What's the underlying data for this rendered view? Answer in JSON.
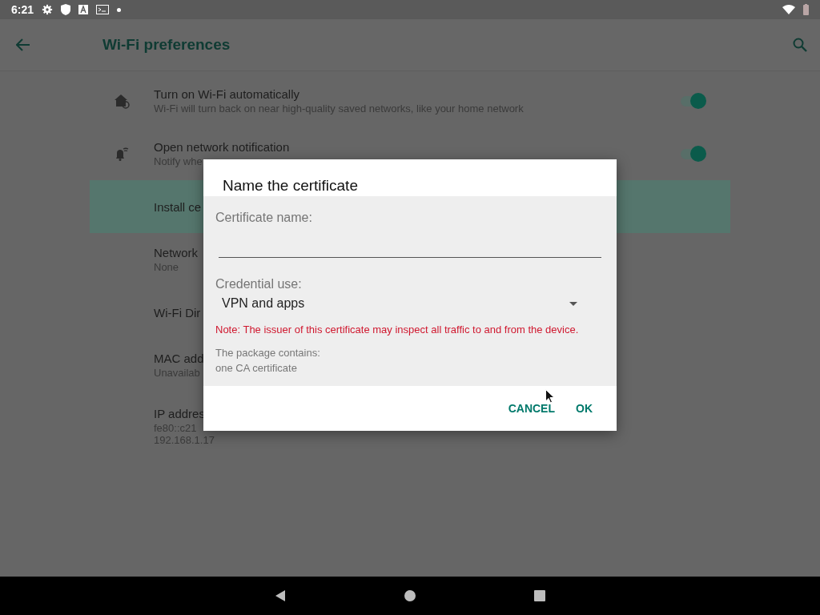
{
  "status_bar": {
    "time": "6:21"
  },
  "app_bar": {
    "title": "Wi-Fi preferences"
  },
  "settings": [
    {
      "title": "Turn on Wi-Fi automatically",
      "summary": "Wi-Fi will turn back on near high-quality saved networks, like your home network",
      "kind": "toggle",
      "on": true,
      "selected": false
    },
    {
      "title": "Open network notification",
      "summary": "Notify whe",
      "kind": "toggle",
      "on": true,
      "selected": false
    },
    {
      "title": "Install ce",
      "kind": "plain",
      "selected": true
    },
    {
      "title": "Network",
      "summary": "None",
      "kind": "plain",
      "selected": false
    },
    {
      "title": "Wi-Fi Dir",
      "kind": "plain",
      "selected": false
    },
    {
      "title": "MAC add",
      "summary": "Unavailab",
      "kind": "plain",
      "selected": false
    },
    {
      "title": "IP addres",
      "summary": "fe80::c21\n192.168.1.17",
      "kind": "plain",
      "selected": false
    }
  ],
  "dialog": {
    "title": "Name the certificate",
    "name_label": "Certificate name:",
    "use_label": "Credential use:",
    "use_value": "VPN and apps",
    "note": "Note: The issuer of this certificate may inspect all traffic to and from the device.",
    "package_label": "The package contains:",
    "package_value": "one CA certificate",
    "buttons": [
      "CANCEL",
      "OK"
    ]
  }
}
